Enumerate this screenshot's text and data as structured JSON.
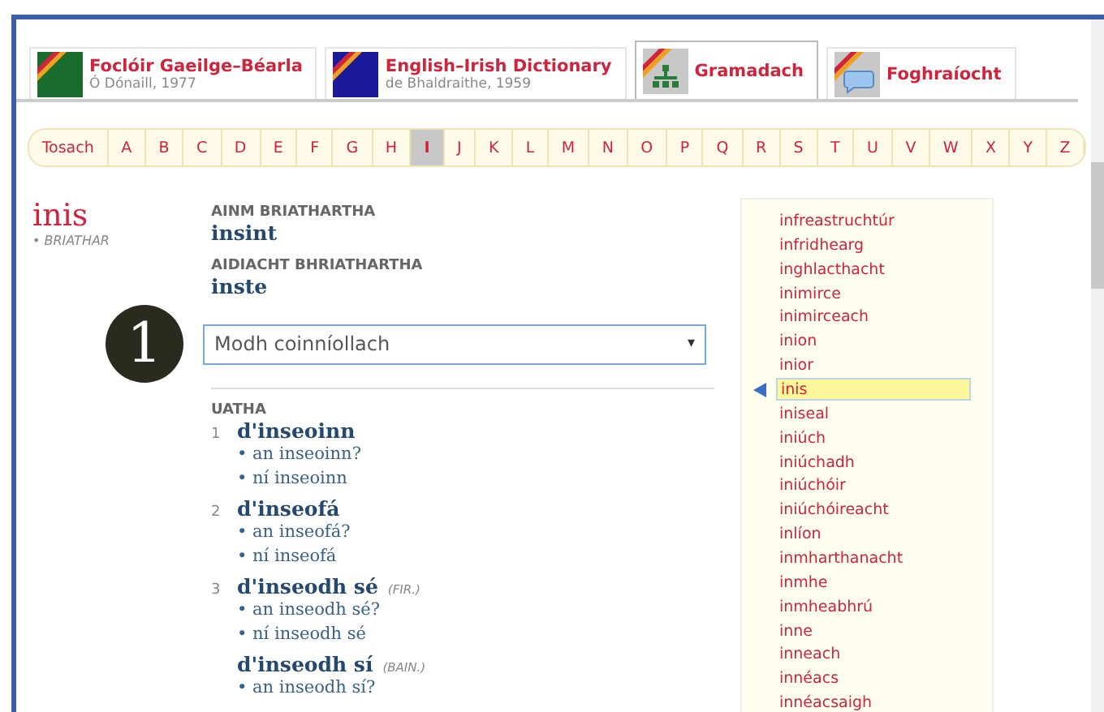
{
  "tabs": [
    {
      "title": "Foclóir Gaeilge–Béarla",
      "subtitle": "Ó Dónaill, 1977",
      "kind": "irish",
      "selected": false
    },
    {
      "title": "English–Irish Dictionary",
      "subtitle": "de Bhaldraithe, 1959",
      "kind": "english",
      "selected": false
    },
    {
      "title": "Gramadach",
      "kind": "grammar",
      "selected": true
    },
    {
      "title": "Foghraíocht",
      "kind": "phonetics",
      "selected": false
    }
  ],
  "alphabet": [
    {
      "label": "Tosach",
      "selected": false
    },
    {
      "label": "A",
      "selected": false
    },
    {
      "label": "B",
      "selected": false
    },
    {
      "label": "C",
      "selected": false
    },
    {
      "label": "D",
      "selected": false
    },
    {
      "label": "E",
      "selected": false
    },
    {
      "label": "F",
      "selected": false
    },
    {
      "label": "G",
      "selected": false
    },
    {
      "label": "H",
      "selected": false
    },
    {
      "label": "I",
      "selected": true
    },
    {
      "label": "J",
      "selected": false
    },
    {
      "label": "K",
      "selected": false
    },
    {
      "label": "L",
      "selected": false
    },
    {
      "label": "M",
      "selected": false
    },
    {
      "label": "N",
      "selected": false
    },
    {
      "label": "O",
      "selected": false
    },
    {
      "label": "P",
      "selected": false
    },
    {
      "label": "Q",
      "selected": false
    },
    {
      "label": "R",
      "selected": false
    },
    {
      "label": "S",
      "selected": false
    },
    {
      "label": "T",
      "selected": false
    },
    {
      "label": "U",
      "selected": false
    },
    {
      "label": "V",
      "selected": false
    },
    {
      "label": "W",
      "selected": false
    },
    {
      "label": "X",
      "selected": false
    },
    {
      "label": "Y",
      "selected": false
    },
    {
      "label": "Z",
      "selected": false
    }
  ],
  "headword": {
    "word": "inis",
    "pos": "• BRIATHAR"
  },
  "sections": [
    {
      "label": "AINM BRIATHARTHA",
      "value": "insint"
    },
    {
      "label": "AIDIACHT BHRIATHARTHA",
      "value": "inste"
    }
  ],
  "callout": "1",
  "mood_select": {
    "value": "Modh coinníollach",
    "arrow": "▾"
  },
  "forms": {
    "heading": "UATHA",
    "items": [
      {
        "number": "1",
        "form": "d'inseoinn",
        "variants": [
          "• an inseoinn?",
          "• ní inseoinn"
        ]
      },
      {
        "number": "2",
        "form": "d'inseofá",
        "variants": [
          "• an inseofá?",
          "• ní inseofá"
        ]
      },
      {
        "number": "3",
        "form": "d'inseodh sé",
        "gender": "(FIR.)",
        "variants": [
          "• an inseodh sé?",
          "• ní inseodh sé"
        ]
      },
      {
        "form": "d'inseodh sí",
        "gender": "(BAIN.)",
        "variants": [
          "• an inseodh sí?"
        ]
      }
    ]
  },
  "word_list": [
    {
      "word": "infreastruchtúr",
      "selected": false
    },
    {
      "word": "infridhearg",
      "selected": false
    },
    {
      "word": "inghlacthacht",
      "selected": false
    },
    {
      "word": "inimirce",
      "selected": false
    },
    {
      "word": "inimirceach",
      "selected": false
    },
    {
      "word": "inion",
      "selected": false
    },
    {
      "word": "inior",
      "selected": false
    },
    {
      "word": "inis",
      "selected": true
    },
    {
      "word": "iniseal",
      "selected": false
    },
    {
      "word": "iniúch",
      "selected": false
    },
    {
      "word": "iniúchadh",
      "selected": false
    },
    {
      "word": "iniúchóir",
      "selected": false
    },
    {
      "word": "iniúchóireacht",
      "selected": false
    },
    {
      "word": "inlíon",
      "selected": false
    },
    {
      "word": "inmharthanacht",
      "selected": false
    },
    {
      "word": "inmhe",
      "selected": false
    },
    {
      "word": "inmheabhrú",
      "selected": false
    },
    {
      "word": "inne",
      "selected": false
    },
    {
      "word": "inneach",
      "selected": false
    },
    {
      "word": "innéacs",
      "selected": false
    },
    {
      "word": "innéacsaigh",
      "selected": false
    }
  ]
}
